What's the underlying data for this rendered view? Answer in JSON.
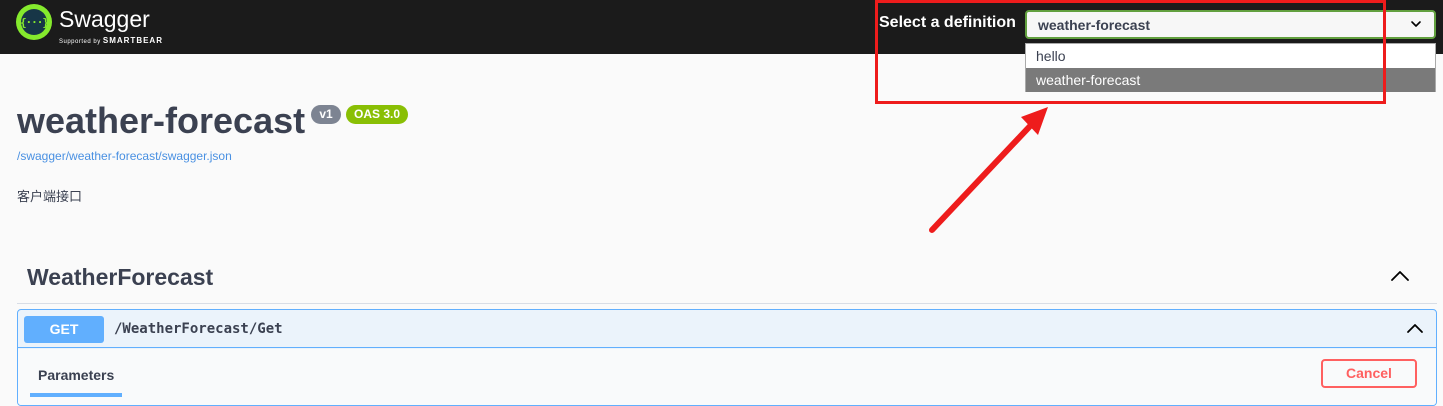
{
  "topbar": {
    "brand_name": "Swagger",
    "brand_tagline_prefix": "Supported by",
    "brand_tagline_company": "SMARTBEAR",
    "logo_glyph": "{···}",
    "select_label": "Select a definition",
    "selected_definition": "weather-forecast",
    "definition_options": [
      "hello",
      "weather-forecast"
    ]
  },
  "info": {
    "title": "weather-forecast",
    "version_badge": "v1",
    "oas_badge": "OAS 3.0",
    "spec_link": "/swagger/weather-forecast/swagger.json",
    "description": "客户端接口"
  },
  "tag": {
    "name": "WeatherForecast",
    "operation": {
      "method": "GET",
      "path": "/WeatherForecast/Get",
      "tab_label": "Parameters",
      "cancel_label": "Cancel"
    }
  },
  "colors": {
    "topbar_bg": "#1b1b1b",
    "accent_green": "#85ea2d",
    "get_blue": "#61affe",
    "annotation_red": "#ee1c1c",
    "cancel_red": "#ff6060"
  },
  "icons": [
    "swagger-logo-icon",
    "chevron-down-icon",
    "chevron-up-icon",
    "annotation-arrow-icon"
  ]
}
